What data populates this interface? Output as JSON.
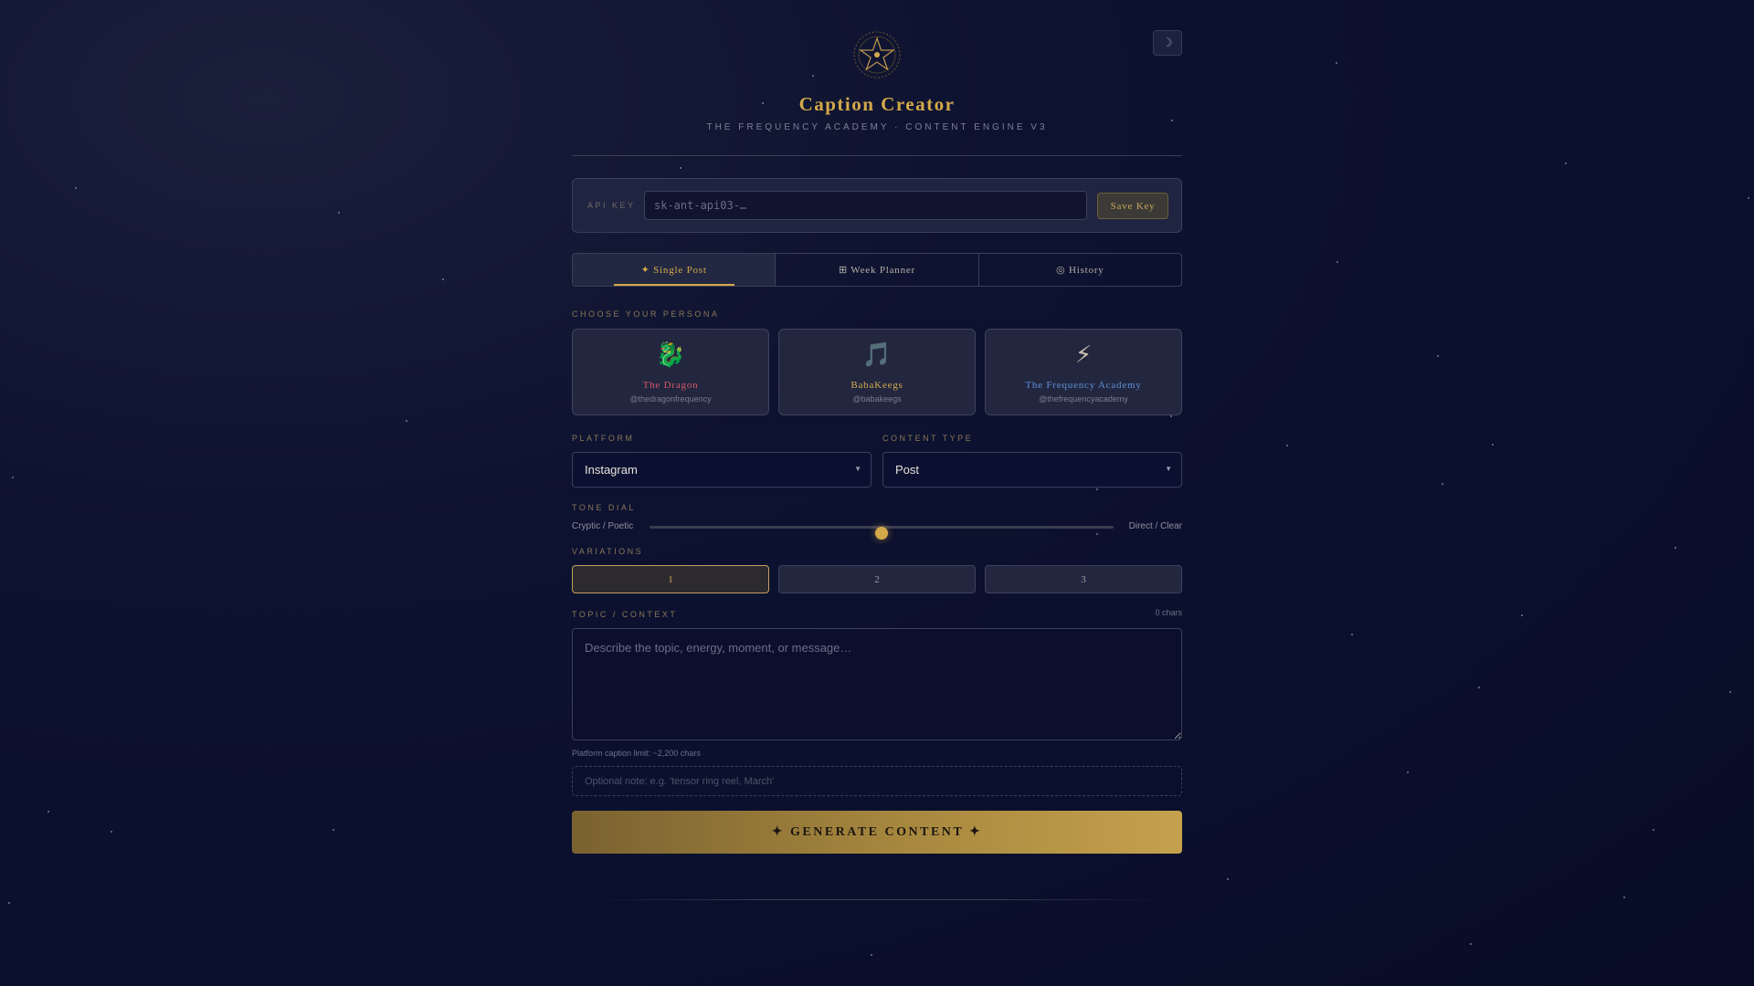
{
  "header": {
    "title": "Caption Creator",
    "subtitle": "THE FREQUENCY ACADEMY · CONTENT ENGINE V3",
    "theme_toggle": "☽",
    "logo": "pentagram-star-icon"
  },
  "api": {
    "label": "API KEY",
    "placeholder": "sk-ant-api03-…",
    "value": "",
    "save_label": "Save Key"
  },
  "tabs": [
    {
      "label": "✦ Single Post",
      "active": true
    },
    {
      "label": "⊞ Week Planner",
      "active": false
    },
    {
      "label": "◎ History",
      "active": false
    }
  ],
  "persona": {
    "label": "CHOOSE YOUR PERSONA",
    "items": [
      {
        "emoji": "🐉",
        "name": "The Dragon",
        "handle": "@thedragonfrequency",
        "color": "#d8566a"
      },
      {
        "emoji": "🎵",
        "name": "BabaKeegs",
        "handle": "@babakeegs",
        "color": "#d4a94a"
      },
      {
        "emoji": "⚡",
        "name": "The Frequency Academy",
        "handle": "@thefrequencyacademy",
        "color": "#5f8fd8"
      }
    ]
  },
  "platform": {
    "label": "PLATFORM",
    "selected": "Instagram"
  },
  "content_type": {
    "label": "CONTENT TYPE",
    "selected": "Post"
  },
  "tone": {
    "label": "TONE DIAL",
    "left": "Cryptic / Poetic",
    "right": "Direct / Clear",
    "value": 0.5
  },
  "variations": {
    "label": "VARIATIONS",
    "options": [
      "1",
      "2",
      "3"
    ],
    "selected": "1"
  },
  "topic": {
    "label": "TOPIC / CONTEXT",
    "char_count": "0 chars",
    "placeholder": "Describe the topic, energy, moment, or message…",
    "limit_note": "Platform caption limit: ~2,200 chars"
  },
  "note": {
    "placeholder": "Optional note: e.g. 'tensor ring reel, March'"
  },
  "generate_label": "✦ GENERATE CONTENT ✦",
  "colors": {
    "accent": "#d4a94a",
    "background": "#0a0f2c"
  }
}
